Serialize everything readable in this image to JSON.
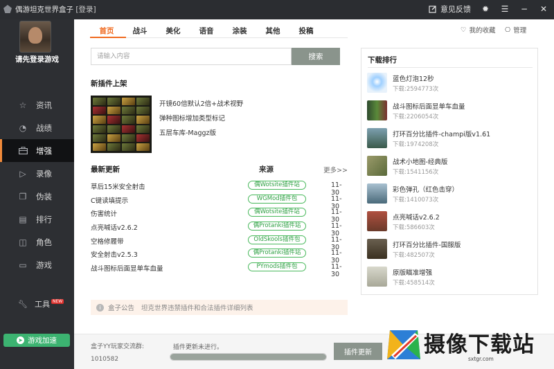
{
  "titlebar": {
    "app_name": "偶游坦克世界盒子",
    "login_label": "[登录]",
    "feedback_label": "意见反馈"
  },
  "sidebar": {
    "login_hint": "请先登录游戏",
    "items": [
      {
        "label": "资讯",
        "icon": "star-icon"
      },
      {
        "label": "战绩",
        "icon": "chart-icon"
      },
      {
        "label": "增强",
        "icon": "toolbox-icon",
        "active": true
      },
      {
        "label": "录像",
        "icon": "video-icon"
      },
      {
        "label": "伪装",
        "icon": "layers-icon"
      },
      {
        "label": "排行",
        "icon": "ranking-icon"
      },
      {
        "label": "角色",
        "icon": "person-icon"
      },
      {
        "label": "游戏",
        "icon": "gamepad-icon"
      }
    ],
    "tools_label": "工具",
    "new_badge": "NEW",
    "accel_label": "游戏加速"
  },
  "tabs": [
    "首页",
    "战斗",
    "美化",
    "语音",
    "涂装",
    "其他",
    "投稿"
  ],
  "header_right": {
    "favorites_label": "我的收藏",
    "manage_label": "管理"
  },
  "search": {
    "placeholder": "请输入内容",
    "button_label": "搜索"
  },
  "new_plugins": {
    "title": "新插件上架",
    "items": [
      "开镜60倍默认2倍+战术视野",
      "弹种图标增加类型标记",
      "五层车库-Maggz版"
    ]
  },
  "latest": {
    "title": "最新更新",
    "source_header": "来源",
    "more_label": "更多>>",
    "rows": [
      {
        "name": "草后15米安全射击",
        "source": "偶Wotsite插件站",
        "date": "11-30"
      },
      {
        "name": "C键读填提示",
        "source": "WGMod插件包",
        "date": "11-30"
      },
      {
        "name": "伤害统计",
        "source": "偶Wotsite插件站",
        "date": "11-30"
      },
      {
        "name": "点亮喊话v2.6.2",
        "source": "偶Protanki插件站",
        "date": "11-30"
      },
      {
        "name": "空格修履带",
        "source": "OldSkools插件包",
        "date": "11-30"
      },
      {
        "name": "安全射击v2.5.3",
        "source": "偶Protanki插件站",
        "date": "11-30"
      },
      {
        "name": "战斗图标后面显单车血量",
        "source": "PYmods插件包",
        "date": "11-30"
      }
    ]
  },
  "notice": {
    "label": "盒子公告",
    "text": "坦克世界违禁插件和合法插件详细列表"
  },
  "ranking": {
    "title": "下载排行",
    "items": [
      {
        "name": "蓝色灯泡12秒",
        "count": "下载:2594773次",
        "color": "#dce9f7"
      },
      {
        "name": "战斗图标后面显单车血量",
        "count": "下载:2206054次",
        "color": "#3a5a3a"
      },
      {
        "name": "打环百分比插件-champi版v1.61",
        "count": "下载:1974208次",
        "color": "#4d6a7a"
      },
      {
        "name": "战术小地图-经典版",
        "count": "下载:1541156次",
        "color": "#8a8a5a"
      },
      {
        "name": "彩色弹孔（红色击穿）",
        "count": "下载:1410073次",
        "color": "#6a8aa0"
      },
      {
        "name": "点亮喊话v2.6.2",
        "count": "下载:586603次",
        "color": "#a04a3a"
      },
      {
        "name": "打环百分比插件-国服版",
        "count": "下载:482507次",
        "color": "#5a5040"
      },
      {
        "name": "原版瞄准增强",
        "count": "下载:458514次",
        "color": "#c8c8b8"
      }
    ]
  },
  "bottom": {
    "qq_label": "盒子YY玩家交流群:",
    "qq_number": "1010582",
    "update_status": "插件更新未进行。",
    "progress": 1.0,
    "update_button": "插件更新"
  },
  "watermark": {
    "text": "摄像下载站",
    "url": "sxtgr.com"
  },
  "colors": {
    "accent": "#f06a1f",
    "sidebar_bg": "#2d2f33",
    "source_green": "#2ea043",
    "accel_green": "#3cb371",
    "button_gray": "#8a948c"
  }
}
